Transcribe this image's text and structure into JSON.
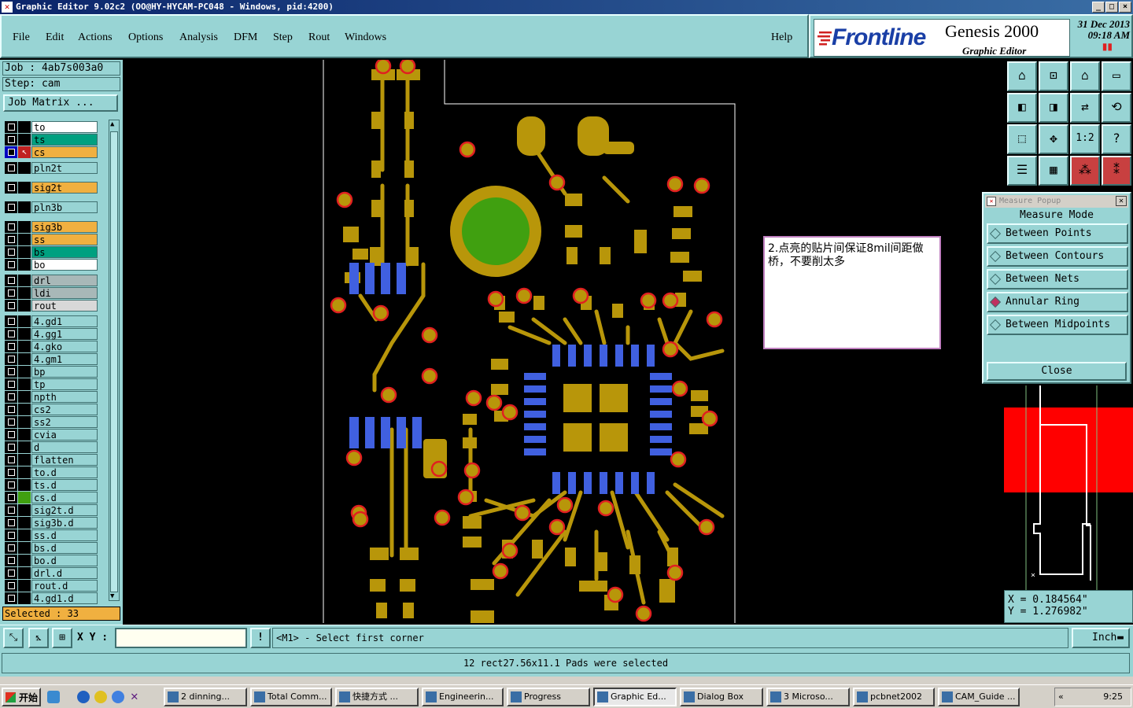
{
  "window": {
    "title": "Graphic Editor 9.02c2  (OO@HY-HYCAM-PC048 - Windows, pid:4200)"
  },
  "menu": [
    {
      "label": "File"
    },
    {
      "label": "Edit"
    },
    {
      "label": "Actions"
    },
    {
      "label": "Options"
    },
    {
      "label": "Analysis"
    },
    {
      "label": "DFM"
    },
    {
      "label": "Step"
    },
    {
      "label": "Rout"
    },
    {
      "label": "Windows"
    }
  ],
  "help_label": "Help",
  "brand": {
    "logo": "Frontline",
    "product": "Genesis 2000",
    "subtitle": "Graphic Editor",
    "date": "31 Dec 2013",
    "time": "09:18 AM"
  },
  "job": {
    "job_line": "Job : 4ab7s003a0",
    "step_line": "Step: cam",
    "matrix_button": "Job Matrix ..."
  },
  "layers": [
    {
      "name": "to",
      "color": "#ffffff"
    },
    {
      "name": "ts",
      "color": "#00a080"
    },
    {
      "name": "cs",
      "color": "#f0b040"
    },
    {
      "name": "pln2t",
      "color": "#98d4d4"
    },
    {
      "name": "sig2t",
      "color": "#f0b040"
    },
    {
      "name": "pln3b",
      "color": "#98d4d4"
    },
    {
      "name": "sig3b",
      "color": "#f0b040"
    },
    {
      "name": "ss",
      "color": "#f0b040"
    },
    {
      "name": "bs",
      "color": "#00a080"
    },
    {
      "name": "bo",
      "color": "#ffffff"
    },
    {
      "name": "drl",
      "color": "#a8b8b8"
    },
    {
      "name": "ldi",
      "color": "#a8b8b8"
    },
    {
      "name": "rout",
      "color": "#d8d8d8"
    },
    {
      "name": "4.gd1",
      "color": "#98d4d4"
    },
    {
      "name": "4.gg1",
      "color": "#98d4d4"
    },
    {
      "name": "4.gko",
      "color": "#98d4d4"
    },
    {
      "name": "4.gm1",
      "color": "#98d4d4"
    },
    {
      "name": "bp",
      "color": "#98d4d4"
    },
    {
      "name": "tp",
      "color": "#98d4d4"
    },
    {
      "name": "npth",
      "color": "#98d4d4"
    },
    {
      "name": "cs2",
      "color": "#98d4d4"
    },
    {
      "name": "ss2",
      "color": "#98d4d4"
    },
    {
      "name": "cvia",
      "color": "#98d4d4"
    },
    {
      "name": "d",
      "color": "#98d4d4"
    },
    {
      "name": "flatten",
      "color": "#98d4d4"
    },
    {
      "name": "to.d",
      "color": "#98d4d4"
    },
    {
      "name": "ts.d",
      "color": "#98d4d4"
    },
    {
      "name": "cs.d",
      "color": "#98d4d4"
    },
    {
      "name": "sig2t.d",
      "color": "#98d4d4"
    },
    {
      "name": "sig3b.d",
      "color": "#98d4d4"
    },
    {
      "name": "ss.d",
      "color": "#98d4d4"
    },
    {
      "name": "bs.d",
      "color": "#98d4d4"
    },
    {
      "name": "bo.d",
      "color": "#98d4d4"
    },
    {
      "name": "drl.d",
      "color": "#98d4d4"
    },
    {
      "name": "rout.d",
      "color": "#98d4d4"
    },
    {
      "name": "4.gd1.d",
      "color": "#98d4d4"
    }
  ],
  "selected_label": "Selected : 33",
  "measure": {
    "title": "Measure Popup",
    "heading": "Measure Mode",
    "options": [
      "Between Points",
      "Between Contours",
      "Between Nets",
      "Annular Ring",
      "Between Midpoints"
    ],
    "active": "Annular Ring",
    "close": "Close"
  },
  "coords": {
    "x": "X = 0.184564\"",
    "y": "Y = 1.276982\""
  },
  "note": {
    "text": "2.点亮的贴片间保证8mil间距做桥，不要削太多"
  },
  "command": {
    "xy_label": "X Y :",
    "xy_value": "",
    "prompt": "<M1> - Select first corner",
    "unit": "Inch"
  },
  "status": {
    "message": "12 rect27.56x11.1 Pads were selected"
  },
  "taskbar": {
    "start": "开始",
    "tasks": [
      "2 dinning...",
      "Total Comm...",
      "快捷方式 ...",
      "Engineerin...",
      "Progress",
      "Graphic Ed...",
      "Dialog Box",
      "3 Microso...",
      "pcbnet2002",
      "CAM_Guide ..."
    ],
    "active": "Graphic Ed...",
    "clock": "9:25"
  },
  "colors": {
    "panel": "#98d4d4",
    "copper": "#b8960a",
    "pad_blue": "#4060e0",
    "drill_red": "#e02020",
    "highlight_green": "#40a010"
  }
}
